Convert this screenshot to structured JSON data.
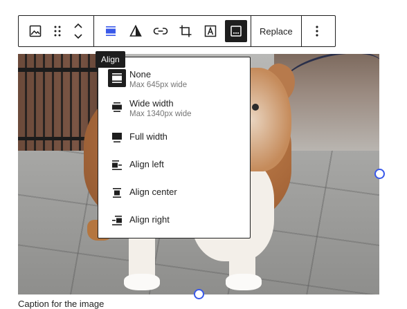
{
  "toolbar": {
    "replace_label": "Replace",
    "active_color": "#1e1e1e",
    "accent_color": "#3858e9"
  },
  "tooltip": {
    "text": "Align"
  },
  "align_menu": {
    "items": [
      {
        "label": "None",
        "sub": "Max 645px wide",
        "icon": "align-none-icon",
        "selected": true
      },
      {
        "label": "Wide width",
        "sub": "Max 1340px wide",
        "icon": "align-wide-icon"
      },
      {
        "label": "Full width",
        "sub": "",
        "icon": "align-full-icon"
      },
      {
        "label": "Align left",
        "sub": "",
        "icon": "align-left-icon"
      },
      {
        "label": "Align center",
        "sub": "",
        "icon": "align-center-icon"
      },
      {
        "label": "Align right",
        "sub": "",
        "icon": "align-right-icon"
      }
    ]
  },
  "image": {
    "caption": "Caption for the image"
  }
}
